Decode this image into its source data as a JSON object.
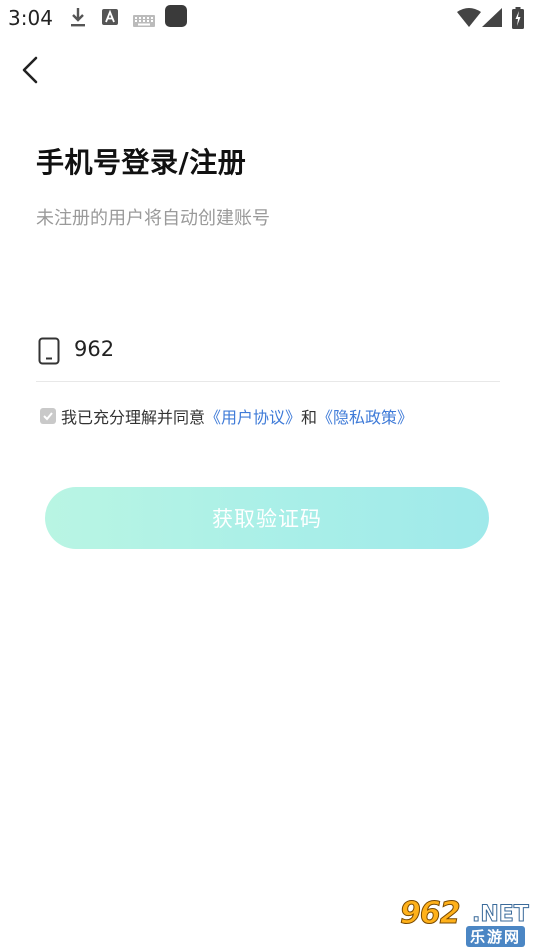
{
  "status_bar": {
    "time": "3:04",
    "icons": [
      "download-icon",
      "ime-icon",
      "keyboard-icon",
      "app-icon",
      "wifi-icon",
      "signal-icon",
      "battery-icon"
    ]
  },
  "nav": {
    "back_icon": "chevron-left-icon"
  },
  "header": {
    "title": "手机号登录/注册",
    "subtitle": "未注册的用户将自动创建账号"
  },
  "phone_field": {
    "icon": "phone-icon",
    "value": "962"
  },
  "agreement": {
    "checked": true,
    "text": "我已充分理解并同意",
    "user_agreement": "《用户协议》",
    "and": "和",
    "privacy_policy": "《隐私政策》"
  },
  "get_code_button": {
    "label": "获取验证码"
  },
  "colors": {
    "link": "#3f7bd8",
    "button_gradient_start": "#b9f5e3",
    "button_gradient_end": "#9fe9ea",
    "subtitle": "#9a9a9a"
  },
  "watermark": {
    "number": "962",
    "net": ".NET",
    "sub": "乐游网"
  }
}
